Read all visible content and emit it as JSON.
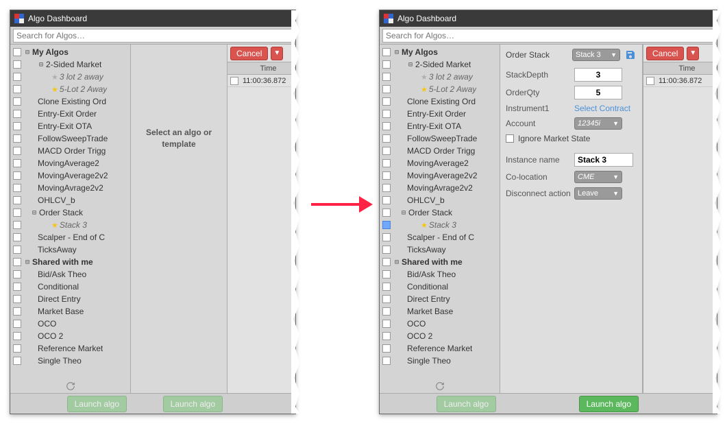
{
  "window_title": "Algo Dashboard",
  "search_placeholder": "Search for Algos…",
  "tree": {
    "my_algos": "My Algos",
    "shared": "Shared with me",
    "items_my": [
      {
        "label": "2-Sided Market",
        "expandable": true
      },
      {
        "label": "3 lot 2 away",
        "star": "grey",
        "indent": 3,
        "italic": true
      },
      {
        "label": "5-Lot 2 Away",
        "star": "gold",
        "indent": 3,
        "italic": true
      },
      {
        "label": "Clone Existing Ord",
        "indent": 1
      },
      {
        "label": "Entry-Exit Order",
        "indent": 1
      },
      {
        "label": "Entry-Exit OTA",
        "indent": 1
      },
      {
        "label": "FollowSweepTrade",
        "indent": 1
      },
      {
        "label": "MACD Order Trigg",
        "indent": 1
      },
      {
        "label": "MovingAverage2",
        "indent": 1
      },
      {
        "label": "MovingAverage2v2",
        "indent": 1
      },
      {
        "label": "MovingAvrage2v2",
        "indent": 1
      },
      {
        "label": "OHLCV_b",
        "indent": 1
      },
      {
        "label": "Order Stack",
        "expandable": true,
        "indent": 0
      },
      {
        "label": "Stack 3",
        "star": "gold",
        "indent": 3,
        "italic": true,
        "selectable": true
      },
      {
        "label": "Scalper - End of C",
        "indent": 1
      },
      {
        "label": "TicksAway",
        "indent": 1
      }
    ],
    "items_shared": [
      {
        "label": "Bid/Ask Theo"
      },
      {
        "label": "Conditional"
      },
      {
        "label": "Direct Entry"
      },
      {
        "label": "Market Base"
      },
      {
        "label": "OCO"
      },
      {
        "label": "OCO 2"
      },
      {
        "label": "Reference Market"
      },
      {
        "label": "Single Theo"
      }
    ]
  },
  "placeholder_line1": "Select an algo or",
  "placeholder_line2": "template",
  "cancel_label": "Cancel",
  "time_header": "Time",
  "time_row": "11:00:36.872",
  "launch_label": "Launch algo",
  "params": {
    "panel_title": "Order Stack",
    "template_select": "Stack 3",
    "stack_depth_label": "StackDepth",
    "stack_depth_value": "3",
    "order_qty_label": "OrderQty",
    "order_qty_value": "5",
    "instrument_label": "Instrument1",
    "instrument_link": "Select Contract",
    "account_label": "Account",
    "account_value": "12345i",
    "ignore_label": "Ignore Market State",
    "instance_name_label": "Instance name",
    "instance_name_value": "Stack 3",
    "coloc_label": "Co-location",
    "coloc_value": "CME",
    "disc_label": "Disconnect action",
    "disc_value": "Leave"
  }
}
